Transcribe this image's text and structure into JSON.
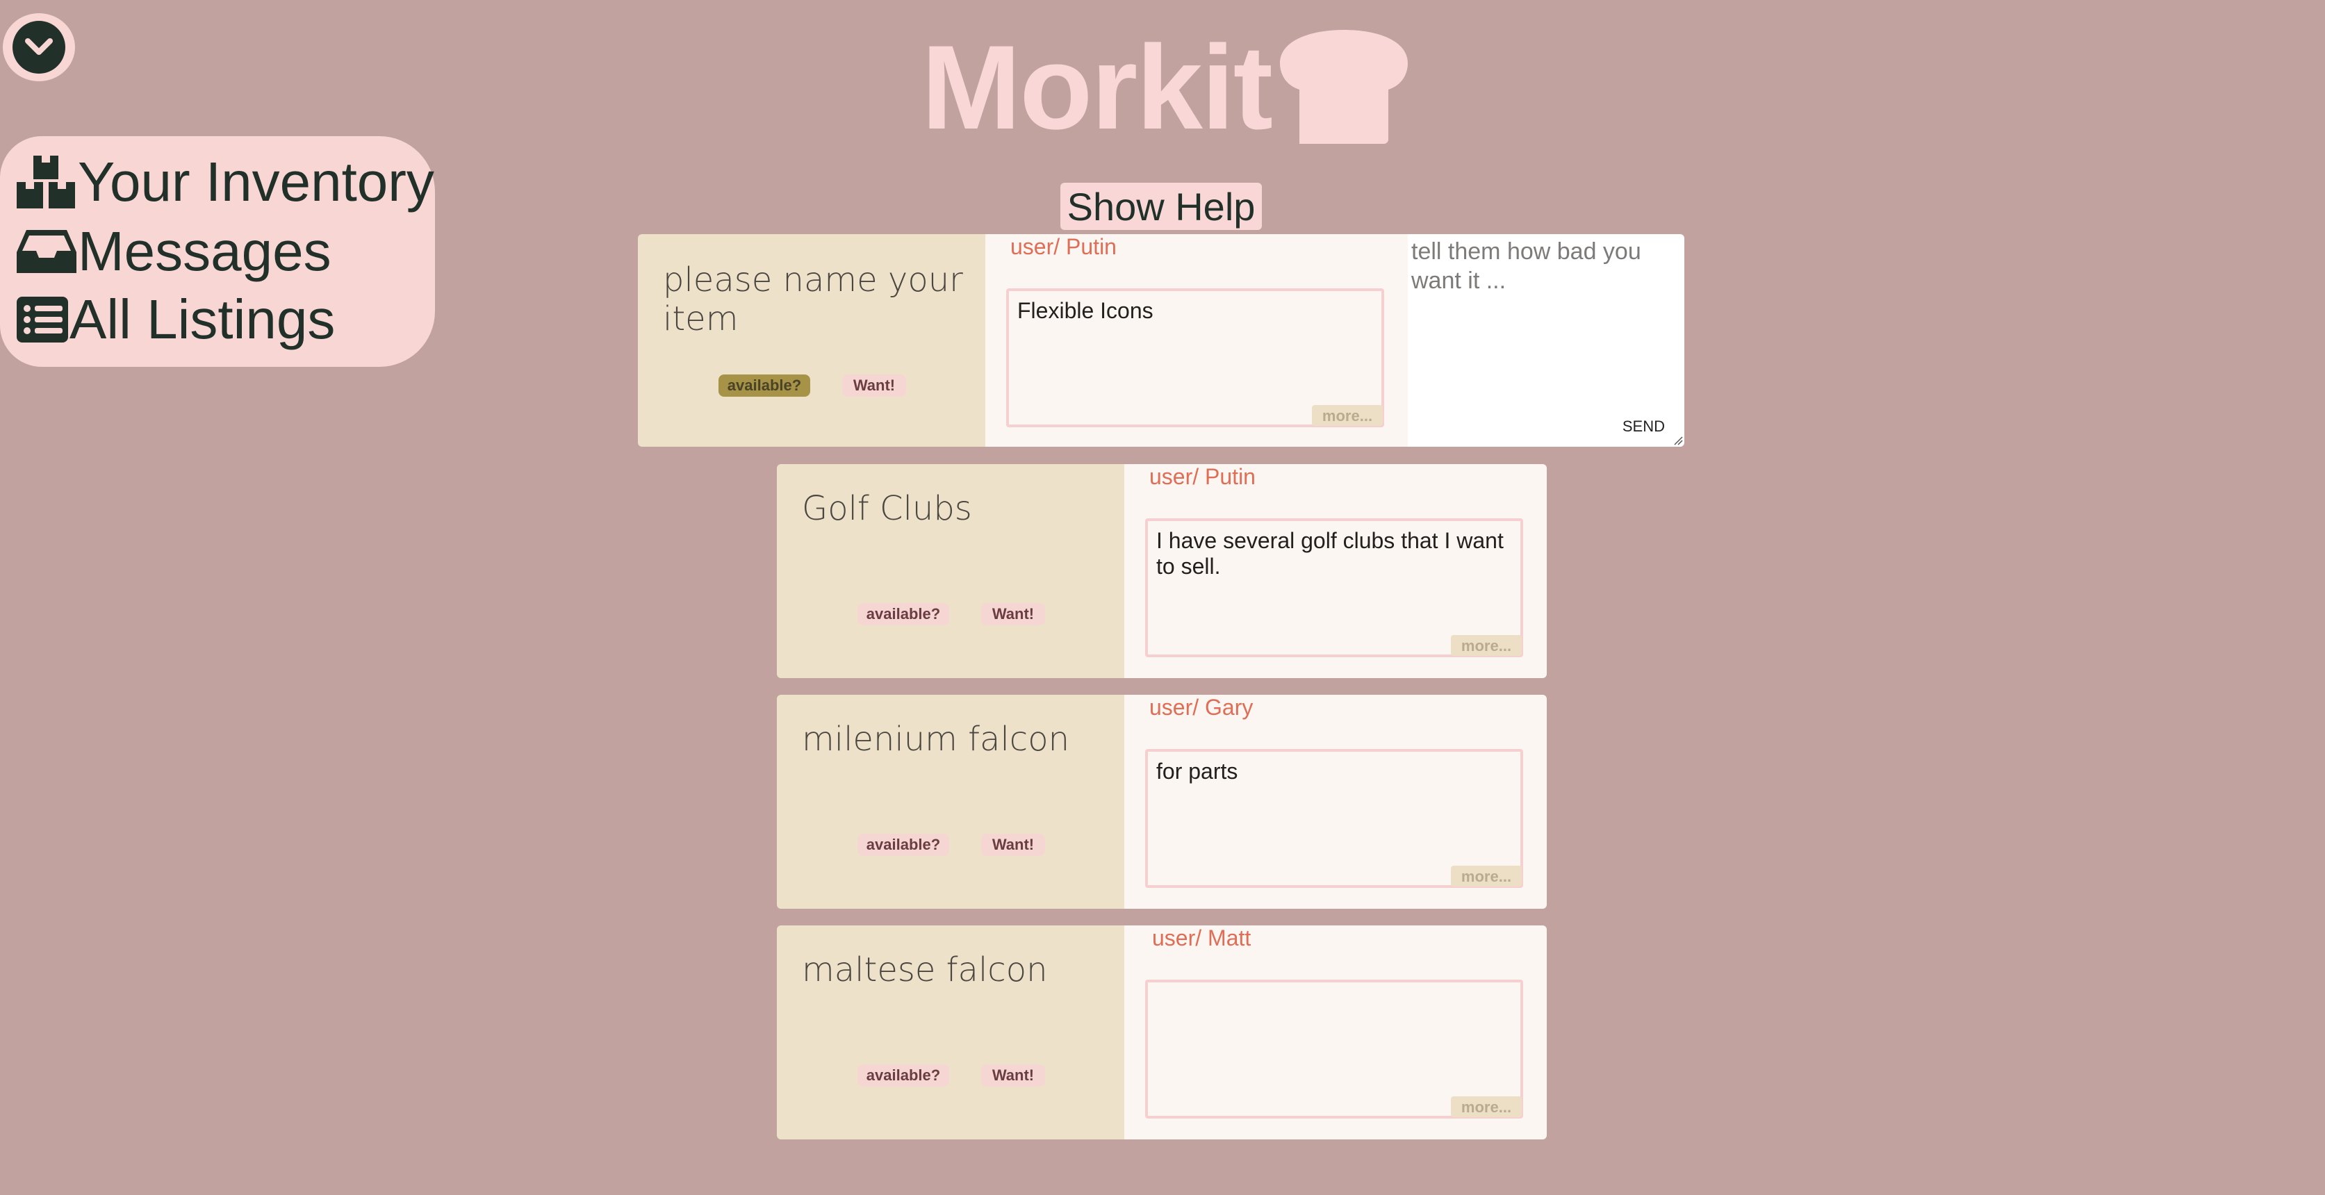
{
  "app": {
    "title": "Morkit",
    "show_help_label": "Show Help"
  },
  "nav": {
    "items": [
      {
        "label": "Your Inventory",
        "icon": "boxes-icon"
      },
      {
        "label": "Messages",
        "icon": "inbox-icon"
      },
      {
        "label": "All Listings",
        "icon": "list-icon"
      }
    ]
  },
  "listings": [
    {
      "title": "please name your item",
      "user": "user/ Putin",
      "description": "Flexible Icons",
      "available_label": "available?",
      "available_active": true,
      "want_label": "Want!",
      "more_label": "more..."
    },
    {
      "title": "Golf Clubs",
      "user": "user/ Putin",
      "description": "I have several golf clubs that I want to sell.",
      "available_label": "available?",
      "available_active": false,
      "want_label": "Want!",
      "more_label": "more..."
    },
    {
      "title": "milenium falcon",
      "user": "user/ Gary",
      "description": "for parts",
      "available_label": "available?",
      "available_active": false,
      "want_label": "Want!",
      "more_label": "more..."
    },
    {
      "title": "maltese falcon",
      "user": "user/ Matt",
      "description": "",
      "available_label": "available?",
      "available_active": false,
      "want_label": "Want!",
      "more_label": "more..."
    }
  ],
  "message": {
    "placeholder": "tell them how bad you want it ...",
    "send_label": "SEND"
  },
  "colors": {
    "background": "#c1a29f",
    "pink": "#f7d6d4",
    "dark": "#22302a",
    "card_left": "#ede1ca",
    "card_right": "#fbf6f1",
    "user_label": "#e06d56",
    "active_pill": "#a69347"
  }
}
